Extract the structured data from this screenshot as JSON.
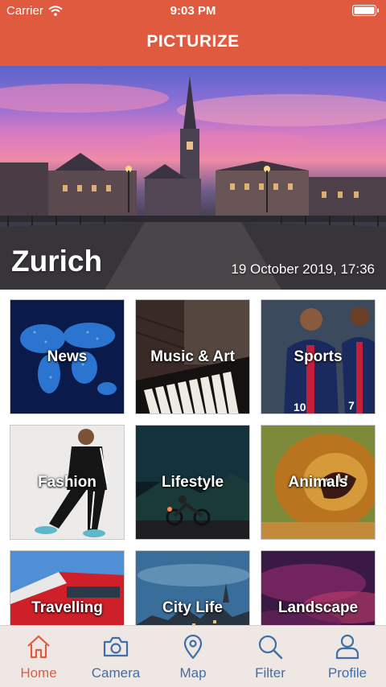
{
  "status_bar": {
    "carrier": "Carrier",
    "time": "9:03 PM"
  },
  "nav": {
    "title": "PICTURIZE"
  },
  "hero": {
    "city": "Zurich",
    "date": "19 October 2019, 17:36"
  },
  "categories": [
    {
      "label": "News"
    },
    {
      "label": "Music & Art"
    },
    {
      "label": "Sports"
    },
    {
      "label": "Fashion"
    },
    {
      "label": "Lifestyle"
    },
    {
      "label": "Animals"
    },
    {
      "label": "Travelling"
    },
    {
      "label": "City Life"
    },
    {
      "label": "Landscape"
    }
  ],
  "tabs": [
    {
      "label": "Home",
      "icon": "home-icon",
      "active": true
    },
    {
      "label": "Camera",
      "icon": "camera-icon",
      "active": false
    },
    {
      "label": "Map",
      "icon": "map-pin-icon",
      "active": false
    },
    {
      "label": "Filter",
      "icon": "search-icon",
      "active": false
    },
    {
      "label": "Profile",
      "icon": "person-icon",
      "active": false
    }
  ],
  "colors": {
    "accent": "#e05a3f",
    "tab_inactive": "#3f6fa8",
    "tabbar_bg": "#efe7e4"
  }
}
